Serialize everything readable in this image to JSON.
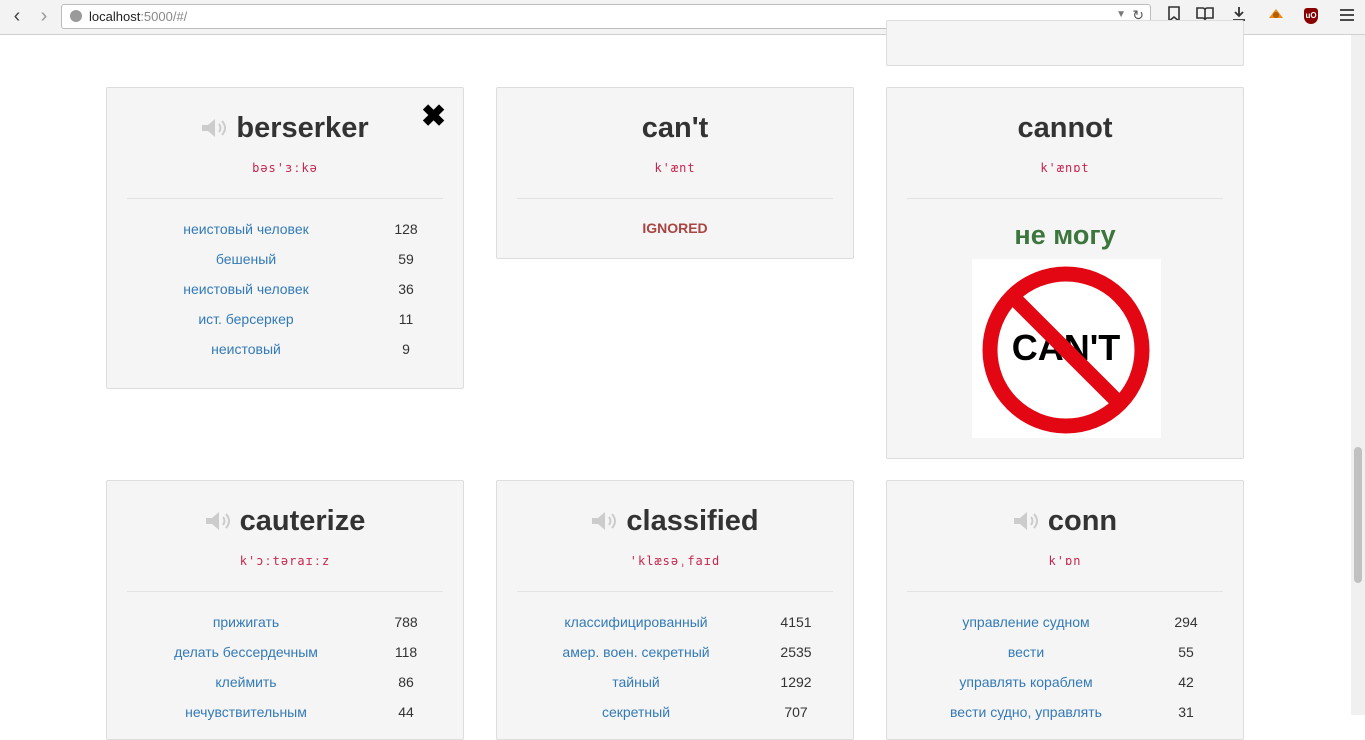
{
  "browser": {
    "url_host": "localhost",
    "url_rest": ":5000/#/"
  },
  "cards": {
    "berserker": {
      "word": "berserker",
      "ipa": "bəs'ɜːkə",
      "close_symbol": "✖",
      "translations": [
        {
          "text": "неистовый человек",
          "count": "128"
        },
        {
          "text": "бешеный",
          "count": "59"
        },
        {
          "text": "неистовый человек",
          "count": "36"
        },
        {
          "text": "ист. берсеркер",
          "count": "11"
        },
        {
          "text": "неистовый",
          "count": "9"
        }
      ]
    },
    "cant": {
      "word": "can't",
      "ipa": "k'ænt",
      "status": "IGNORED"
    },
    "cannot": {
      "word": "cannot",
      "ipa": "k'ænɒt",
      "ru_translation": "не могу",
      "image_text": "CAN'T"
    },
    "cauterize": {
      "word": "cauterize",
      "ipa": "k'ɔːtəraɪːz",
      "translations": [
        {
          "text": "прижигать",
          "count": "788"
        },
        {
          "text": "делать бессердечным",
          "count": "118"
        },
        {
          "text": "клеймить",
          "count": "86"
        },
        {
          "text": "нечувствительным",
          "count": "44"
        }
      ]
    },
    "classified": {
      "word": "classified",
      "ipa": "'klæsəˌfaɪd",
      "translations": [
        {
          "text": "классифицированный",
          "count": "4151"
        },
        {
          "text": "амер. воен. секретный",
          "count": "2535"
        },
        {
          "text": "тайный",
          "count": "1292"
        },
        {
          "text": "секретный",
          "count": "707"
        }
      ]
    },
    "conn": {
      "word": "conn",
      "ipa": "k'ɒn",
      "translations": [
        {
          "text": "управление судном",
          "count": "294"
        },
        {
          "text": "вести",
          "count": "55"
        },
        {
          "text": "управлять кораблем",
          "count": "42"
        },
        {
          "text": "вести судно, управлять",
          "count": "31"
        }
      ]
    }
  },
  "colors": {
    "link": "#337ab7",
    "ipa": "#c7254e",
    "ignored": "#a94442",
    "ru_word": "#3c763d"
  }
}
